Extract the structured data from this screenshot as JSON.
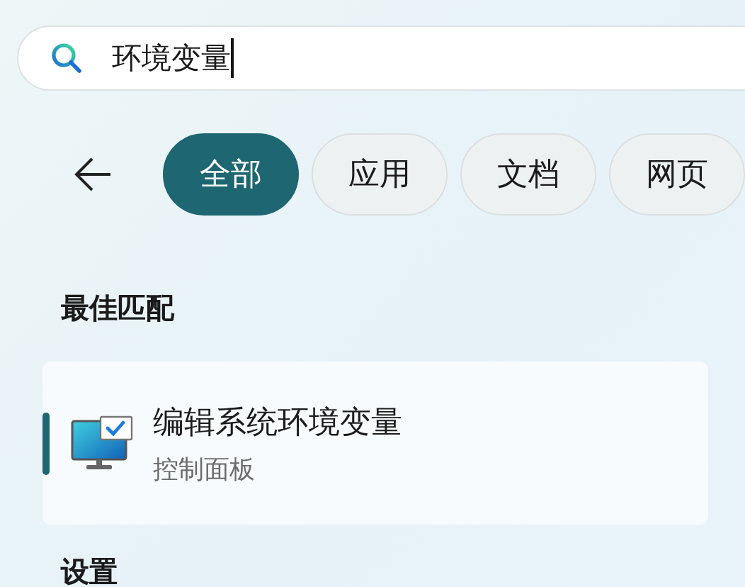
{
  "search": {
    "value": "环境变量"
  },
  "filters": [
    {
      "label": "全部",
      "selected": true
    },
    {
      "label": "应用",
      "selected": false
    },
    {
      "label": "文档",
      "selected": false
    },
    {
      "label": "网页",
      "selected": false
    }
  ],
  "best_match": {
    "heading": "最佳匹配",
    "item": {
      "title": "编辑系统环境变量",
      "subtitle": "控制面板",
      "selected": true
    }
  },
  "next_section": {
    "heading": "设置"
  }
}
